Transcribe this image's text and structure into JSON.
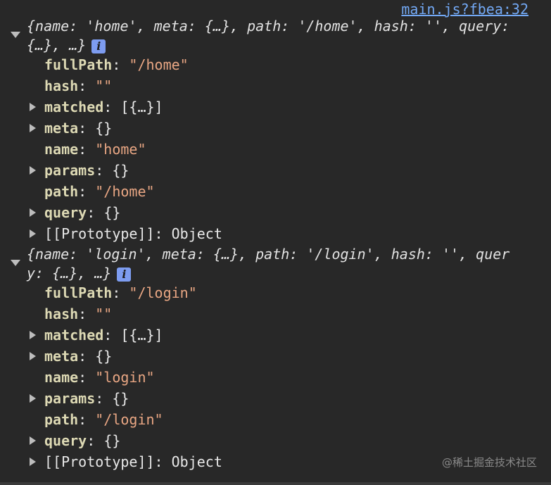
{
  "source_link": "main.js?fbea:32",
  "watermark": "@稀土掘金技术社区",
  "objects": [
    {
      "summary_line1": "{name: 'home', meta: {…}, path: '/home', hash: '', query:",
      "summary_line2": "{…}, …}",
      "info_icon": "i",
      "props": [
        {
          "key": "fullPath",
          "sep": ": ",
          "value": "\"/home\"",
          "kind": "str"
        },
        {
          "key": "hash",
          "sep": ": ",
          "value": "\"\"",
          "kind": "str"
        },
        {
          "key": "matched",
          "sep": ": ",
          "value": "[{…}]",
          "kind": "plain"
        },
        {
          "key": "meta",
          "sep": ": ",
          "value": "{}",
          "kind": "plain"
        },
        {
          "key": "name",
          "sep": ": ",
          "value": "\"home\"",
          "kind": "str"
        },
        {
          "key": "params",
          "sep": ": ",
          "value": "{}",
          "kind": "plain"
        },
        {
          "key": "path",
          "sep": ": ",
          "value": "\"/home\"",
          "kind": "str"
        },
        {
          "key": "query",
          "sep": ": ",
          "value": "{}",
          "kind": "plain"
        },
        {
          "key": "[[Prototype]]",
          "sep": ": ",
          "value": "Object",
          "kind": "plain"
        }
      ]
    },
    {
      "summary_line1": "{name: 'login', meta: {…}, path: '/login', hash: '', quer",
      "summary_line2": "y: {…}, …}",
      "info_icon": "i",
      "props": [
        {
          "key": "fullPath",
          "sep": ": ",
          "value": "\"/login\"",
          "kind": "str"
        },
        {
          "key": "hash",
          "sep": ": ",
          "value": "\"\"",
          "kind": "str"
        },
        {
          "key": "matched",
          "sep": ": ",
          "value": "[{…}]",
          "kind": "plain"
        },
        {
          "key": "meta",
          "sep": ": ",
          "value": "{}",
          "kind": "plain"
        },
        {
          "key": "name",
          "sep": ": ",
          "value": "\"login\"",
          "kind": "str"
        },
        {
          "key": "params",
          "sep": ": ",
          "value": "{}",
          "kind": "plain"
        },
        {
          "key": "path",
          "sep": ": ",
          "value": "\"/login\"",
          "kind": "str"
        },
        {
          "key": "query",
          "sep": ": ",
          "value": "{}",
          "kind": "plain"
        },
        {
          "key": "[[Prototype]]",
          "sep": ": ",
          "value": "Object",
          "kind": "plain"
        }
      ]
    }
  ]
}
